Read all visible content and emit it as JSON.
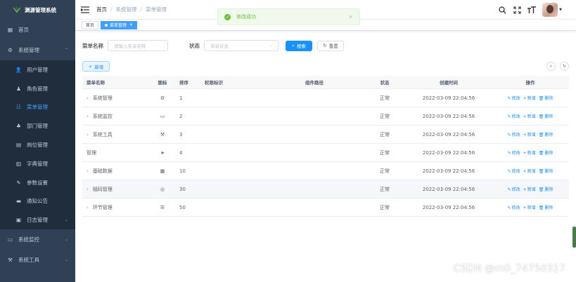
{
  "app": {
    "title": "渊源管理系统"
  },
  "sidebar": {
    "items": [
      {
        "label": "首页",
        "icon": "dashboard-icon",
        "level": 0
      },
      {
        "label": "系统管理",
        "icon": "gear-icon",
        "level": 0,
        "expanded": true
      },
      {
        "label": "用户管理",
        "icon": "user-icon",
        "level": 1
      },
      {
        "label": "角色管理",
        "icon": "role-icon",
        "level": 1
      },
      {
        "label": "菜单管理",
        "icon": "tree-table-icon",
        "level": 1,
        "active": true
      },
      {
        "label": "部门管理",
        "icon": "tree-icon",
        "level": 1
      },
      {
        "label": "岗位管理",
        "icon": "post-icon",
        "level": 1
      },
      {
        "label": "字典管理",
        "icon": "dict-icon",
        "level": 1
      },
      {
        "label": "参数设置",
        "icon": "edit-icon",
        "level": 1
      },
      {
        "label": "通知公告",
        "icon": "message-icon",
        "level": 1
      },
      {
        "label": "日志管理",
        "icon": "log-icon",
        "level": 1
      },
      {
        "label": "系统监控",
        "icon": "monitor-icon",
        "level": 0
      },
      {
        "label": "系统工具",
        "icon": "tool-icon",
        "level": 0
      }
    ]
  },
  "breadcrumb": [
    "首页",
    "系统管理",
    "菜单管理"
  ],
  "tags": [
    {
      "label": "首页",
      "active": false
    },
    {
      "label": "菜单管理",
      "active": true
    }
  ],
  "toast": {
    "message": "修改成功"
  },
  "search": {
    "name_label": "菜单名称",
    "name_placeholder": "请输入菜单名称",
    "status_label": "状态",
    "status_placeholder": "菜单状态",
    "search_btn": "搜索",
    "reset_btn": "重置"
  },
  "toolbar": {
    "add_btn": "新增"
  },
  "table": {
    "headers": [
      "菜单名称",
      "图标",
      "排序",
      "权限标识",
      "组件路径",
      "状态",
      "创建时间",
      "操作"
    ],
    "rows": [
      {
        "name": "系统管理",
        "expandable": true,
        "icon": "system-icon",
        "order": "1",
        "perm": "",
        "path": "",
        "status": "正常",
        "created": "2022-03-09 22:04:56"
      },
      {
        "name": "系统监控",
        "expandable": true,
        "icon": "monitor-icon",
        "order": "2",
        "perm": "",
        "path": "",
        "status": "正常",
        "created": "2022-03-09 22:04:56"
      },
      {
        "name": "系统工具",
        "expandable": true,
        "icon": "tool-icon",
        "order": "3",
        "perm": "",
        "path": "",
        "status": "正常",
        "created": "2022-03-09 22:04:56"
      },
      {
        "name": "管理",
        "expandable": false,
        "icon": "guide-icon",
        "order": "4",
        "perm": "",
        "path": "",
        "status": "正常",
        "created": "2022-03-09 22:04:56"
      },
      {
        "name": "基础数据",
        "expandable": true,
        "icon": "table-icon",
        "order": "10",
        "perm": "",
        "path": "",
        "status": "正常",
        "created": "2022-03-09 22:04:56"
      },
      {
        "name": "赋码管理",
        "expandable": true,
        "icon": "eye-icon",
        "order": "30",
        "perm": "",
        "path": "",
        "status": "正常",
        "created": "2022-03-09 22:04:56",
        "hover": true
      },
      {
        "name": "环节管理",
        "expandable": true,
        "icon": "list-icon",
        "order": "50",
        "perm": "",
        "path": "",
        "status": "正常",
        "created": "2022-03-09 22:04:56"
      }
    ],
    "actions": {
      "edit": "修改",
      "add": "新增",
      "delete": "删除"
    }
  },
  "watermark": "CSDN @m0_74750317"
}
